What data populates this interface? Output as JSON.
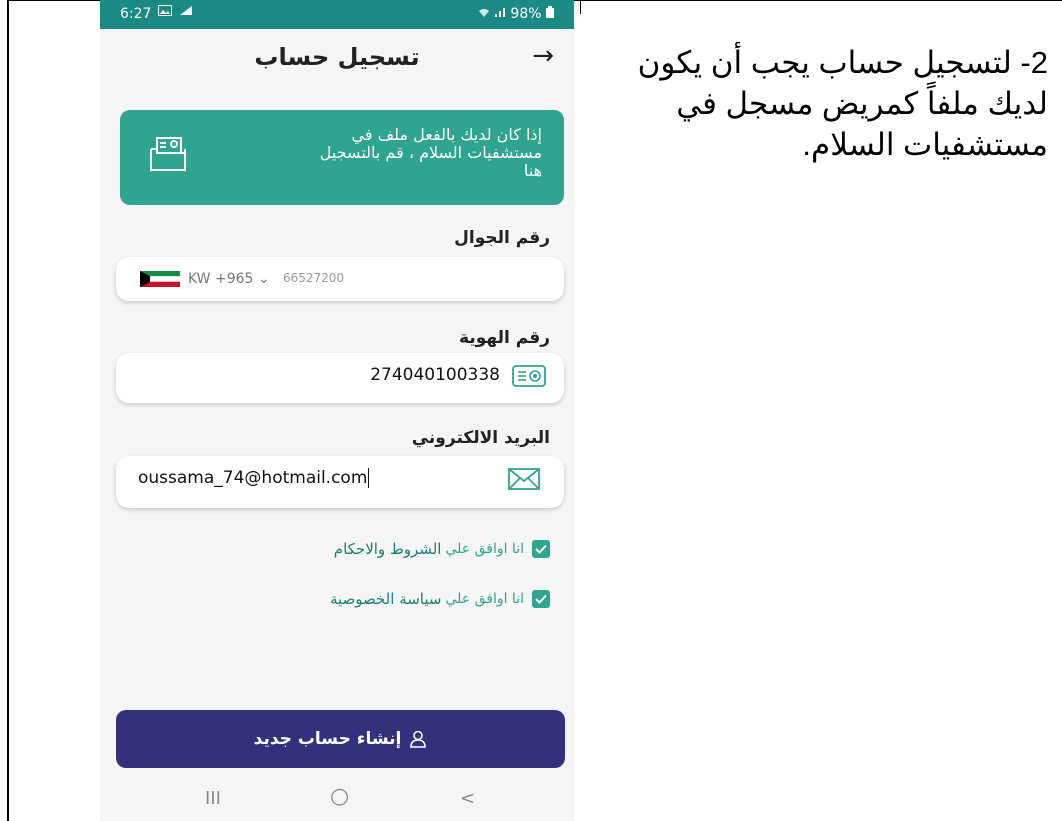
{
  "caption": {
    "line1": "2- لتسجيل حساب يجب أن يكون",
    "line2": "لديك ملفاً كمريض مسجل في",
    "line3": "مستشفيات السلام."
  },
  "status_bar": {
    "time": "6:27",
    "icons_left": [
      "image-icon",
      "signal-icon"
    ],
    "battery": "98%",
    "icons_right": [
      "wifi-icon",
      "signal-icon",
      "battery-icon"
    ]
  },
  "header": {
    "title": "تسجيل حساب",
    "back_icon": "arrow-right-icon"
  },
  "banner": {
    "line1": "إذا كان لديك بالفعل ملف في",
    "line2": "مستشفيات السلام ، قم بالتسجيل",
    "line3": "هنا",
    "icon": "folder-id-card-icon"
  },
  "mobile": {
    "label": "رقم الجوال",
    "country_code": "KW +965",
    "number_placeholder": "66527200",
    "flag": "kuwait-flag"
  },
  "id_number": {
    "label": "رقم الهوية",
    "value": "274040100338",
    "icon": "id-card-icon"
  },
  "email": {
    "label": "البريد الالكتروني",
    "value": "oussama_74@hotmail.com",
    "icon": "envelope-icon"
  },
  "checkboxes": [
    {
      "prefix": "انا اوافق علي",
      "link": "الشروط والاحكام",
      "checked": true
    },
    {
      "prefix": "انا اوافق علي",
      "link": "سياسة الخصوصية",
      "checked": true
    }
  ],
  "create_button": {
    "label": "إنشاء حساب جديد",
    "icon": "user-icon"
  },
  "nav_bar": {
    "recents": "III",
    "home": "○",
    "back": "<"
  },
  "colors": {
    "status_bar": "#1b8a84",
    "accent": "#2fa58f",
    "button": "#33307e"
  }
}
